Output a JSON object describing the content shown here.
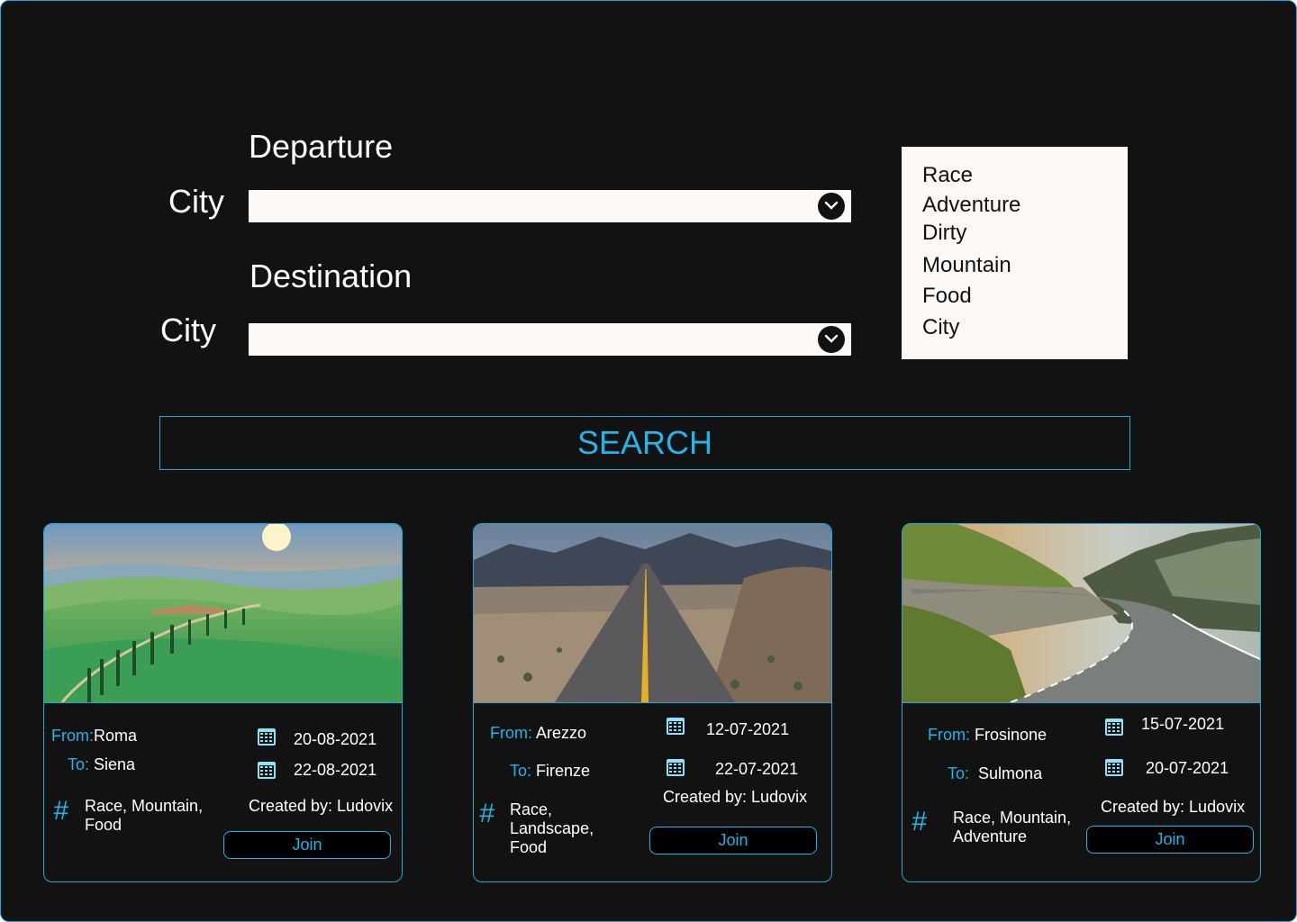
{
  "departure": {
    "heading": "Departure",
    "city_label": "City"
  },
  "destination": {
    "heading": "Destination",
    "city_label": "City"
  },
  "categories": [
    "Race",
    "Adventure",
    "Dirty",
    "Mountain",
    "Food",
    "City"
  ],
  "search": {
    "label": "SEARCH"
  },
  "colors": {
    "accent": "#22b5ea",
    "background": "#121212",
    "border": "#1fa8d6",
    "field": "#fcf9f7"
  },
  "cards": [
    {
      "from_key": "From:",
      "from": "Roma",
      "to_key": "To:",
      "to": "Siena",
      "date_start": "20-08-2021",
      "date_end": "22-08-2021",
      "tags": "Race, Mountain,\nFood",
      "created_by": "Created by: Ludovix",
      "join": "Join",
      "image": "tuscan-hills-sunset"
    },
    {
      "from_key": "From:",
      "from": "Arezzo",
      "to_key": "To:",
      "to": "Firenze",
      "date_start": "12-07-2021",
      "date_end": "22-07-2021",
      "tags": "Race,\nLandscape,\nFood",
      "created_by": "Created by: Ludovix",
      "join": "Join",
      "image": "desert-road"
    },
    {
      "from_key": "From:",
      "from": "Frosinone",
      "to_key": "To:",
      "to": "Sulmona",
      "date_start": "15-07-2021",
      "date_end": "20-07-2021",
      "tags": "Race, Mountain,\nAdventure",
      "created_by": "Created by: Ludovix",
      "join": "Join",
      "image": "mountain-curve-road"
    }
  ]
}
